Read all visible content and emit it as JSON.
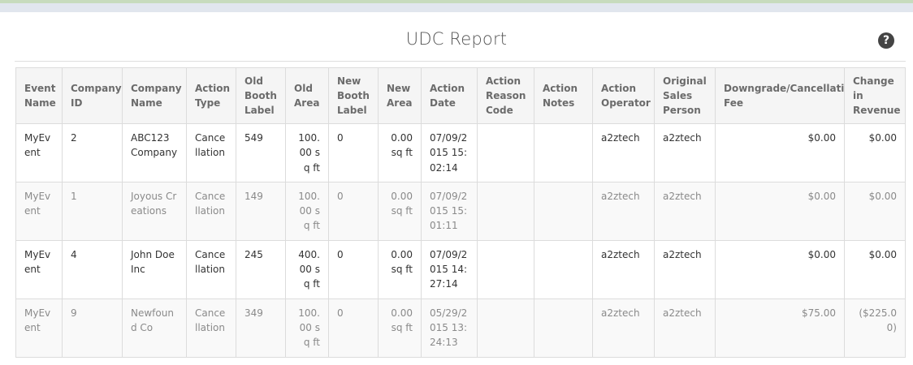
{
  "page": {
    "title": "UDC Report",
    "help_glyph": "?"
  },
  "table": {
    "columns": [
      "Event Name",
      "Company ID",
      "Company Name",
      "Action Type",
      "Old Booth Label",
      "Old Area",
      "New Booth Label",
      "New Area",
      "Action Date",
      "Action Reason Code",
      "Action Notes",
      "Action Operator",
      "Original Sales Person",
      "Downgrade/Cancellation Fee",
      "Change in Revenue"
    ],
    "rows": [
      [
        "MyEvent",
        "2",
        "ABC123 Company",
        "Cancellation",
        "549",
        "100.00 sq ft",
        "0",
        "0.00 sq ft",
        "07/09/2015 15:02:14",
        "",
        "",
        "a2ztech",
        "a2ztech",
        "$0.00",
        "$0.00"
      ],
      [
        "MyEvent",
        "1",
        "Joyous Creations",
        "Cancellation",
        "149",
        "100.00 sq ft",
        "0",
        "0.00 sq ft",
        "07/09/2015 15:01:11",
        "",
        "",
        "a2ztech",
        "a2ztech",
        "$0.00",
        "$0.00"
      ],
      [
        "MyEvent",
        "4",
        "John Doe Inc",
        "Cancellation",
        "245",
        "400.00 sq ft",
        "0",
        "0.00 sq ft",
        "07/09/2015 14:27:14",
        "",
        "",
        "a2ztech",
        "a2ztech",
        "$0.00",
        "$0.00"
      ],
      [
        "MyEvent",
        "9",
        "Newfound Co",
        "Cancellation",
        "349",
        "100.00 sq ft",
        "0",
        "0.00 sq ft",
        "05/29/2015 13:24:13",
        "",
        "",
        "a2ztech",
        "a2ztech",
        "$75.00",
        "($225.00)"
      ]
    ]
  }
}
